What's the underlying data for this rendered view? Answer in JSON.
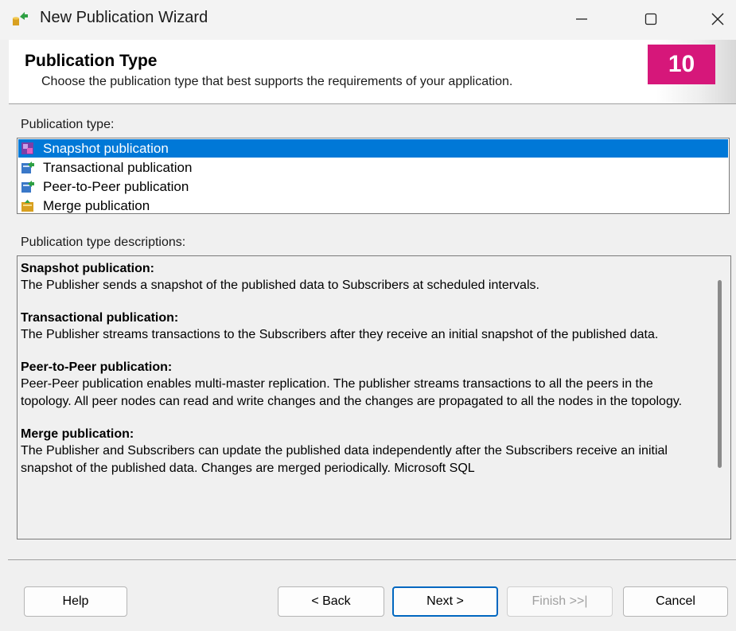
{
  "window": {
    "title": "New Publication Wizard",
    "minimize_glyph": "—",
    "maximize_glyph": "☐",
    "close_glyph": "✕"
  },
  "header": {
    "title": "Publication Type",
    "subtitle": "Choose the publication type that best supports the requirements of your application.",
    "step_badge": "10",
    "badge_color": "#d6177a"
  },
  "publication_type": {
    "label": "Publication type:",
    "selected_index": 0,
    "items": [
      {
        "label": "Snapshot publication",
        "icon": "snapshot-publication-icon"
      },
      {
        "label": "Transactional publication",
        "icon": "transactional-publication-icon"
      },
      {
        "label": "Peer-to-Peer publication",
        "icon": "peer-to-peer-publication-icon"
      },
      {
        "label": "Merge publication",
        "icon": "merge-publication-icon"
      }
    ]
  },
  "descriptions": {
    "label": "Publication type descriptions:",
    "sections": [
      {
        "heading": "Snapshot publication:",
        "text": "The Publisher sends a snapshot of the published data to Subscribers at scheduled intervals."
      },
      {
        "heading": "Transactional publication:",
        "text": "The Publisher streams transactions to the Subscribers after they receive an initial snapshot of the published data."
      },
      {
        "heading": "Peer-to-Peer publication:",
        "text": "Peer-Peer publication enables multi-master replication. The publisher streams transactions to all the peers in the topology. All peer nodes can read and write changes and the changes are propagated to all the nodes in the topology."
      },
      {
        "heading": "Merge publication:",
        "text": "The Publisher and Subscribers can update the published data independently after the Subscribers receive an initial snapshot of the published data. Changes are merged periodically. Microsoft SQL"
      }
    ]
  },
  "buttons": {
    "help": "Help",
    "back": "< Back",
    "next": "Next >",
    "finish": "Finish >>|",
    "cancel": "Cancel"
  },
  "colors": {
    "selection": "#0078d7",
    "default_button_border": "#0067c0"
  }
}
